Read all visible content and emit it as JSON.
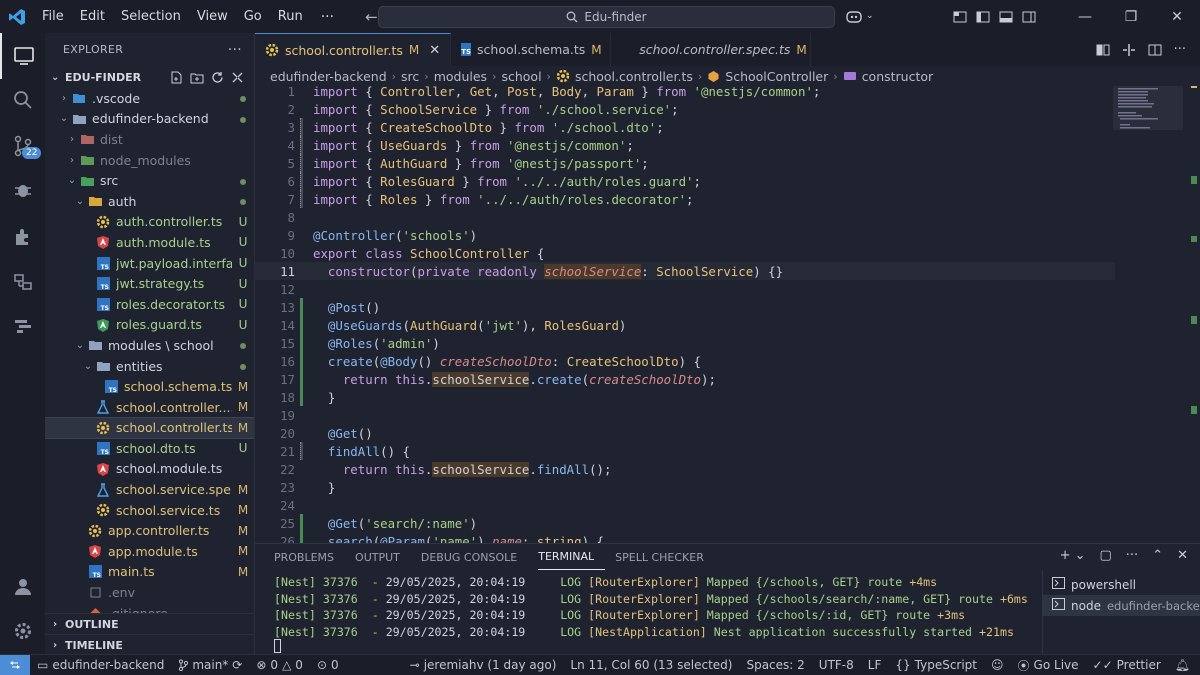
{
  "colors": {
    "accent": "#4c8dd6",
    "modified": "#d9b869",
    "untracked": "#a3d08a",
    "background": "#1f2330"
  },
  "menu": [
    "File",
    "Edit",
    "Selection",
    "View",
    "Go",
    "Run"
  ],
  "menu_more": "···",
  "search": {
    "label": "Edu-finder"
  },
  "activity": {
    "scm_badge": "22"
  },
  "explorer": {
    "title": "EXPLORER",
    "more": "···",
    "root": "EDU-FINDER",
    "items": [
      {
        "name": ".vscode",
        "status": "",
        "dot": true
      },
      {
        "name": "edufinder-backend",
        "status": "",
        "dot": true
      },
      {
        "name": "dist",
        "status": "",
        "dot": false
      },
      {
        "name": "node_modules",
        "status": "",
        "dot": false
      },
      {
        "name": "src",
        "status": "",
        "dot": true
      },
      {
        "name": "auth",
        "status": "",
        "dot": true
      },
      {
        "name": "auth.controller.ts",
        "status": "U"
      },
      {
        "name": "auth.module.ts",
        "status": "U"
      },
      {
        "name": "jwt.payload.interfa...",
        "status": "U"
      },
      {
        "name": "jwt.strategy.ts",
        "status": "U"
      },
      {
        "name": "roles.decorator.ts",
        "status": "U"
      },
      {
        "name": "roles.guard.ts",
        "status": "U"
      },
      {
        "name": "modules \\ school",
        "status": "",
        "dot": true
      },
      {
        "name": "entities",
        "status": "",
        "dot": true
      },
      {
        "name": "school.schema.ts",
        "status": "M"
      },
      {
        "name": "school.controller....",
        "status": "M"
      },
      {
        "name": "school.controller.ts",
        "status": "M"
      },
      {
        "name": "school.dto.ts",
        "status": "U"
      },
      {
        "name": "school.module.ts",
        "status": ""
      },
      {
        "name": "school.service.spe...",
        "status": "M"
      },
      {
        "name": "school.service.ts",
        "status": "M"
      },
      {
        "name": "app.controller.ts",
        "status": "M"
      },
      {
        "name": "app.module.ts",
        "status": "M"
      },
      {
        "name": "main.ts",
        "status": "M"
      },
      {
        "name": ".env",
        "status": ""
      },
      {
        "name": ".gitignore",
        "status": ""
      }
    ],
    "outline": "OUTLINE",
    "timeline": "TIMELINE"
  },
  "tabs": [
    {
      "name": "school.controller.ts",
      "status": "M",
      "close": "✕"
    },
    {
      "name": "school.schema.ts",
      "status": "M"
    },
    {
      "name": "school.controller.spec.ts",
      "status": "M"
    }
  ],
  "breadcrumb": [
    "edufinder-backend",
    "src",
    "modules",
    "school",
    "school.controller.ts",
    "SchoolController",
    "constructor"
  ],
  "editor": {
    "current_line": 11,
    "lines": [
      {
        "n": "1",
        "text": "import { Controller, Get, Post, Body, Param } from '@nestjs/common';"
      },
      {
        "n": "2",
        "text": "import { SchoolService } from './school.service';"
      },
      {
        "n": "3",
        "text": "import { CreateSchoolDto } from './school.dto';"
      },
      {
        "n": "4",
        "text": "import { UseGuards } from '@nestjs/common';"
      },
      {
        "n": "5",
        "text": "import { AuthGuard } from '@nestjs/passport';"
      },
      {
        "n": "6",
        "text": "import { RolesGuard } from '../../auth/roles.guard';"
      },
      {
        "n": "7",
        "text": "import { Roles } from '../../auth/roles.decorator';"
      },
      {
        "n": "8",
        "text": ""
      },
      {
        "n": "9",
        "text": "@Controller('schools')"
      },
      {
        "n": "10",
        "text": "export class SchoolController {"
      },
      {
        "n": "11",
        "text": "  constructor(private readonly schoolService: SchoolService) {}"
      },
      {
        "n": "12",
        "text": ""
      },
      {
        "n": "13",
        "text": "  @Post()"
      },
      {
        "n": "14",
        "text": "  @UseGuards(AuthGuard('jwt'), RolesGuard)"
      },
      {
        "n": "15",
        "text": "  @Roles('admin')"
      },
      {
        "n": "16",
        "text": "  create(@Body() createSchoolDto: CreateSchoolDto) {"
      },
      {
        "n": "17",
        "text": "    return this.schoolService.create(createSchoolDto);"
      },
      {
        "n": "18",
        "text": "  }"
      },
      {
        "n": "19",
        "text": ""
      },
      {
        "n": "20",
        "text": "  @Get()"
      },
      {
        "n": "21",
        "text": "  findAll() {"
      },
      {
        "n": "22",
        "text": "    return this.schoolService.findAll();"
      },
      {
        "n": "23",
        "text": "  }"
      },
      {
        "n": "24",
        "text": ""
      },
      {
        "n": "25",
        "text": "  @Get('search/:name')"
      },
      {
        "n": "26",
        "text": "  search(@Param('name') name: string) {"
      }
    ]
  },
  "panel": {
    "tabs": [
      "PROBLEMS",
      "OUTPUT",
      "DEBUG CONSOLE",
      "TERMINAL",
      "SPELL CHECKER"
    ],
    "active_tab": "TERMINAL",
    "terminal_lines": [
      {
        "prefix": "[Nest] 37376  - ",
        "time": "29/05/2025, 20:04:19",
        "level": "     LOG ",
        "ctx": "[RouterExplorer]",
        "msg": " Mapped {/schools, GET} route ",
        "dur": "+4ms"
      },
      {
        "prefix": "[Nest] 37376  - ",
        "time": "29/05/2025, 20:04:19",
        "level": "     LOG ",
        "ctx": "[RouterExplorer]",
        "msg": " Mapped {/schools/search/:name, GET} route ",
        "dur": "+6ms"
      },
      {
        "prefix": "[Nest] 37376  - ",
        "time": "29/05/2025, 20:04:19",
        "level": "     LOG ",
        "ctx": "[RouterExplorer]",
        "msg": " Mapped {/schools/:id, GET} route ",
        "dur": "+3ms"
      },
      {
        "prefix": "[Nest] 37376  - ",
        "time": "29/05/2025, 20:04:19",
        "level": "     LOG ",
        "ctx": "[NestApplication]",
        "msg": " Nest application successfully started ",
        "dur": "+21ms"
      }
    ],
    "terminals": [
      {
        "name": "powershell",
        "sub": ""
      },
      {
        "name": "node",
        "sub": "edufinder-backe..."
      }
    ]
  },
  "status": {
    "branch_folder": "edufinder-backend",
    "branch": "main*",
    "errors": "0",
    "warnings": "0",
    "blame": "jeremiahv (1 day ago)",
    "position": "Ln 11, Col 60 (13 selected)",
    "spaces": "Spaces: 2",
    "encoding": "UTF-8",
    "eol": "LF",
    "language_brace": "{}",
    "language": "TypeScript",
    "go_live": "Go Live",
    "prettier": "Prettier"
  }
}
